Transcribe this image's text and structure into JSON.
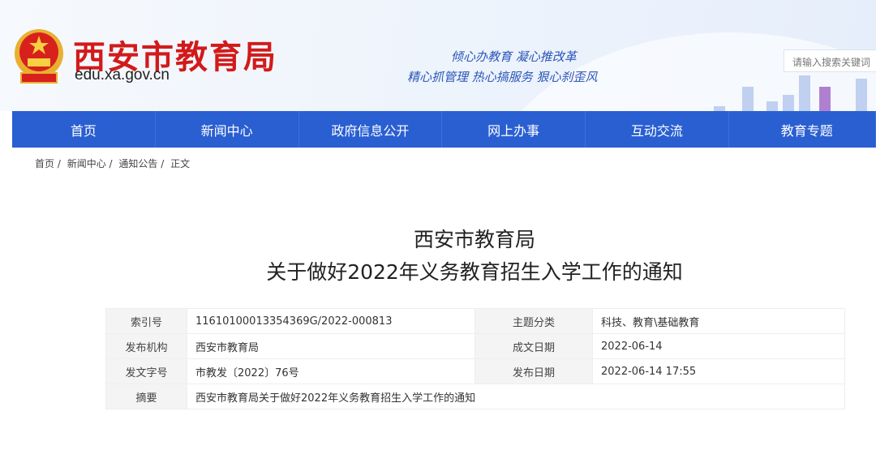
{
  "header": {
    "site_name": "西安市教育局",
    "domain": "edu.xa.gov.cn",
    "slogan_line1": "倾心办教育  凝心推改革",
    "slogan_line2": "精心抓管理  热心搞服务  狠心刹歪风",
    "search_placeholder": "请输入搜索关键词"
  },
  "nav": [
    "首页",
    "新闻中心",
    "政府信息公开",
    "网上办事",
    "互动交流",
    "教育专题"
  ],
  "breadcrumb": [
    "首页 /",
    "新闻中心 /",
    "通知公告 /",
    "正文"
  ],
  "article": {
    "title_line1": "西安市教育局",
    "title_line2": "关于做好2022年义务教育招生入学工作的通知"
  },
  "meta": {
    "index_label": "索引号",
    "index_value": "11610100013354369G/2022-000813",
    "topic_label": "主题分类",
    "topic_value": "科技、教育\\基础教育",
    "org_label": "发布机构",
    "org_value": "西安市教育局",
    "written_label": "成文日期",
    "written_value": "2022-06-14",
    "docno_label": "发文字号",
    "docno_value": "市教发〔2022〕76号",
    "pub_label": "发布日期",
    "pub_value": "2022-06-14 17:55",
    "summary_label": "摘要",
    "summary_value": "西安市教育局关于做好2022年义务教育招生入学工作的通知"
  }
}
